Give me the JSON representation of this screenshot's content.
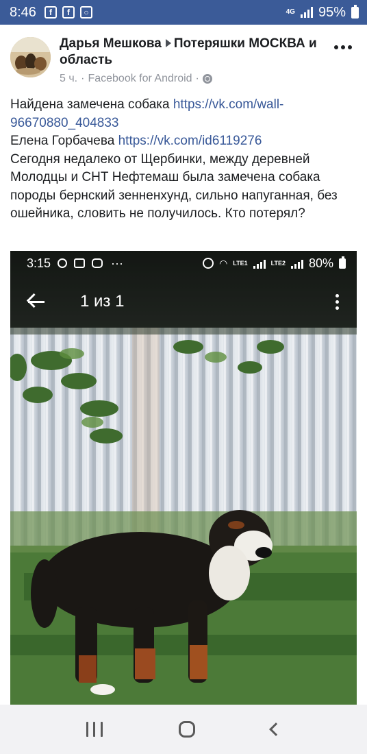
{
  "status_bar": {
    "time": "8:46",
    "network": "4G",
    "battery": "95%"
  },
  "post": {
    "author": "Дарья Мешкова",
    "group": "Потеряшки МОСКВА и область",
    "time_ago": "5 ч.",
    "separator": "·",
    "source": "Facebook for Android",
    "text": {
      "line1": "Найдена замечена собака ",
      "link1": "https://vk.com/wall-96670880_404833",
      "name": "Елена Горбачева ",
      "link2": "https://vk.com/id6119276",
      "body": "Сегодня недалеко от Щербинки, между деревней Молодцы и СНТ Нефтемаш была замечена собака породы бернский зенненхунд, сильно напуганная, без ошейника, словить не получилось. Кто потерял?"
    }
  },
  "photo": {
    "status_time": "3:15",
    "status_battery": "80%",
    "sim1": "LTE1",
    "sim2": "LTE2",
    "counter": "1 из 1"
  },
  "icons": {
    "facebook": "facebook-icon",
    "messenger": "messenger-icon",
    "globe": "globe-icon",
    "more": "more-options-icon",
    "back": "back-arrow-icon",
    "kebab": "kebab-menu-icon",
    "search": "search-icon",
    "gallery": "gallery-icon",
    "instagram": "instagram-icon",
    "alarm": "alarm-icon",
    "wifi": "wifi-icon",
    "nav_recent": "recent-apps-icon",
    "nav_home": "home-icon",
    "nav_back": "back-icon"
  },
  "colors": {
    "status_bar": "#3b5b98",
    "link": "#385898",
    "meta": "#90949c"
  }
}
